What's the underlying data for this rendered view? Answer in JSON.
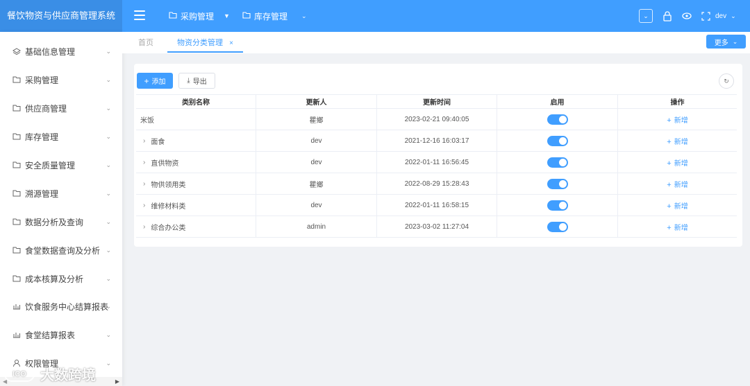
{
  "app": {
    "title": "餐饮物资与供应商管理系统"
  },
  "topnav": [
    {
      "label": "采购管理",
      "icon": "folder-icon"
    },
    {
      "label": "库存管理",
      "icon": "folder-icon"
    }
  ],
  "user": {
    "name": "dev"
  },
  "sidebar": {
    "items": [
      {
        "label": "基础信息管理",
        "icon": "layers-icon"
      },
      {
        "label": "采购管理",
        "icon": "folder-icon"
      },
      {
        "label": "供应商管理",
        "icon": "folder-icon"
      },
      {
        "label": "库存管理",
        "icon": "folder-icon"
      },
      {
        "label": "安全质量管理",
        "icon": "folder-icon"
      },
      {
        "label": "溯源管理",
        "icon": "folder-icon"
      },
      {
        "label": "数据分析及查询",
        "icon": "folder-icon"
      },
      {
        "label": "食堂数据查询及分析",
        "icon": "folder-icon"
      },
      {
        "label": "成本核算及分析",
        "icon": "folder-icon"
      },
      {
        "label": "饮食服务中心结算报表",
        "icon": "bar-chart-icon"
      },
      {
        "label": "食堂结算报表",
        "icon": "bar-chart-icon"
      },
      {
        "label": "权限管理",
        "icon": "user-icon"
      }
    ]
  },
  "tabs": [
    {
      "label": "首页",
      "active": false
    },
    {
      "label": "物资分类管理",
      "active": true
    }
  ],
  "more_label": "更多",
  "toolbar": {
    "add_label": "添加",
    "export_label": "导出"
  },
  "table": {
    "headers": [
      "类别名称",
      "更新人",
      "更新时间",
      "启用",
      "操作"
    ],
    "rows": [
      {
        "name": "米饭",
        "updater": "瞿鄉",
        "time": "2023-02-21 09:40:05",
        "enabled": true,
        "op": "新增",
        "expandable": false
      },
      {
        "name": "面食",
        "updater": "dev",
        "time": "2021-12-16 16:03:17",
        "enabled": true,
        "op": "新增",
        "expandable": true
      },
      {
        "name": "直供物资",
        "updater": "dev",
        "time": "2022-01-11 16:56:45",
        "enabled": true,
        "op": "新增",
        "expandable": true
      },
      {
        "name": "物供领用类",
        "updater": "瞿鄉",
        "time": "2022-08-29 15:28:43",
        "enabled": true,
        "op": "新增",
        "expandable": true
      },
      {
        "name": "维修材料类",
        "updater": "dev",
        "time": "2022-01-11 16:58:15",
        "enabled": true,
        "op": "新增",
        "expandable": true
      },
      {
        "name": "综合办公类",
        "updater": "admin",
        "time": "2023-03-02 11:27:04",
        "enabled": true,
        "op": "新增",
        "expandable": true
      }
    ]
  },
  "watermark": {
    "text": "大数跨境",
    "logo": "ICO"
  },
  "colors": {
    "primary": "#409eff",
    "brand_bg": "#3a8ee6",
    "page_bg": "#f0f2f5"
  }
}
